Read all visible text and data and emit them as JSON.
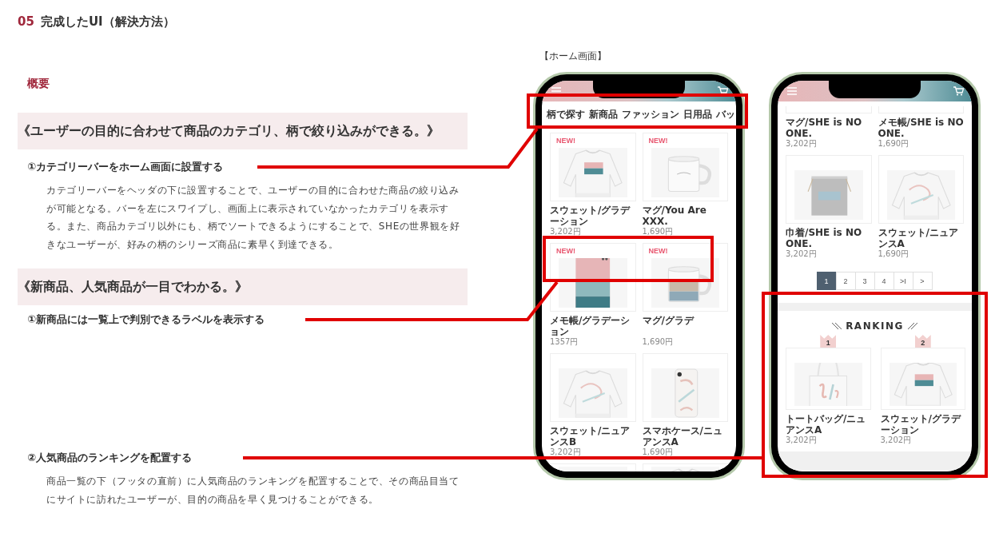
{
  "section": {
    "number": "05",
    "title": "完成したUI（解決方法）"
  },
  "overview": {
    "heading": "概要",
    "groups": [
      {
        "headline": "《ユーザーの目的に合わせて商品のカテゴリ、柄で絞り込みができる。》",
        "points": [
          {
            "title": "①カテゴリーバーをホーム画面に設置する",
            "description": "カテゴリーバーをヘッダの下に設置することで、ユーザーの目的に合わせた商品の絞り込みが可能となる。バーを左にスワイプし、画面上に表示されていなかったカテゴリを表示する。また、商品カテゴリ以外にも、柄でソートできるようにすることで、SHEの世界観を好きなユーザーが、好みの柄のシリーズ商品に素早く到達できる。"
          }
        ]
      },
      {
        "headline": "《新商品、人気商品が一目でわかる。》",
        "points": [
          {
            "title": "①新商品には一覧上で判別できるラベルを表示する"
          },
          {
            "title": "②人気商品のランキングを配置する",
            "description": "商品一覧の下（フッタの直前）に人気商品のランキングを配置することで、その商品目当てにサイトに訪れたユーザーが、目的の商品を早く見つけることができる。"
          }
        ]
      }
    ]
  },
  "screens": [
    {
      "label": "【ホーム画面】",
      "category_bar": [
        "柄で探す",
        "新商品",
        "ファッション",
        "日用品",
        "バッ"
      ],
      "products": [
        {
          "kind": "full",
          "badge": "NEW!",
          "name": "スウェット/グラデーション",
          "price": "3,202円"
        },
        {
          "kind": "full",
          "badge": "NEW!",
          "name": "マグ/You Are XXX.",
          "price": "1,690円"
        },
        {
          "kind": "full",
          "badge": "NEW!",
          "name": "メモ帳/グラデーション",
          "price": "1357円"
        },
        {
          "kind": "full",
          "badge": "NEW!",
          "name": "マグ/グラデ",
          "price": "1,690円"
        },
        {
          "kind": "full",
          "name": "スウェット/ニュアンスB",
          "price": "3,202円"
        },
        {
          "kind": "full",
          "name": "スマホケース/ニュアンスA",
          "price": "1,690円"
        },
        {
          "kind": "image-only"
        },
        {
          "kind": "image-only"
        }
      ]
    },
    {
      "products": [
        {
          "kind": "text-only",
          "name": "マグ/SHE is NO ONE.",
          "price": "3,202円"
        },
        {
          "kind": "text-only",
          "name": "メモ帳/SHE is NO ONE.",
          "price": "1,690円"
        },
        {
          "kind": "full",
          "name": "巾着/SHE is NO ONE.",
          "price": "3,202円"
        },
        {
          "kind": "full",
          "name": "スウェット/ニュアンスA",
          "price": "1,690円"
        }
      ],
      "pagination": [
        {
          "label": "1",
          "selected": true
        },
        {
          "label": "2",
          "selected": false
        },
        {
          "label": "3",
          "selected": false
        },
        {
          "label": "4",
          "selected": false
        },
        {
          "label": ">I",
          "selected": false
        },
        {
          "label": ">",
          "selected": false
        }
      ],
      "ranking": {
        "title": "RANKING",
        "items": [
          {
            "rank": "1",
            "name": "トートバッグ/ニュアンスA",
            "price": "3,202円"
          },
          {
            "rank": "2",
            "name": "スウェット/グラデーション",
            "price": "3,202円"
          }
        ]
      }
    }
  ]
}
